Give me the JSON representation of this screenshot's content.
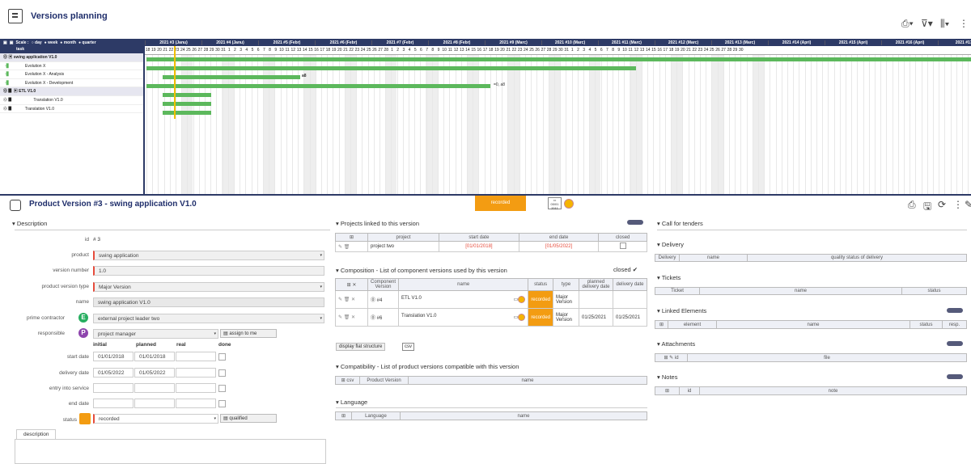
{
  "header": {
    "title": "Versions planning"
  },
  "gantt": {
    "scale_label": "Scale :",
    "scales": [
      "day",
      "week",
      "month",
      "quarter"
    ],
    "task_col": "task",
    "weeks": [
      "2021 #3 (Janu)",
      "2021 #4 (Janu)",
      "2021 #5 (Febr)",
      "2021 #6 (Febr)",
      "2021 #7 (Febr)",
      "2021 #8 (Febr)",
      "2021 #9 (Marc)",
      "2021 #10 (Marc)",
      "2021 #11 (Marc)",
      "2021 #12 (Marc)",
      "2021 #13 (Marc)",
      "2021 #14 (Apri)",
      "2021 #15 (Apri)",
      "2021 #16 (Apri)",
      "2021 #17 (A"
    ],
    "days": [
      "18",
      "19",
      "20",
      "21",
      "22",
      "23",
      "24",
      "25",
      "26",
      "27",
      "28",
      "29",
      "30",
      "31",
      "1",
      "2",
      "3",
      "4",
      "5",
      "6",
      "7",
      "8",
      "9",
      "10",
      "11",
      "12",
      "13",
      "14",
      "15",
      "16",
      "17",
      "18",
      "19",
      "20",
      "21",
      "22",
      "23",
      "24",
      "25",
      "26",
      "27",
      "28",
      "1",
      "2",
      "3",
      "4",
      "5",
      "6",
      "7",
      "8",
      "9",
      "10",
      "11",
      "12",
      "13",
      "14",
      "15",
      "16",
      "17",
      "18",
      "19",
      "20",
      "21",
      "22",
      "23",
      "24",
      "25",
      "26",
      "27",
      "28",
      "29",
      "30",
      "31",
      "1",
      "2",
      "3",
      "4",
      "5",
      "6",
      "7",
      "8",
      "9",
      "10",
      "11",
      "12",
      "13",
      "14",
      "15",
      "16",
      "17",
      "18",
      "19",
      "20",
      "21",
      "22",
      "23",
      "24",
      "25",
      "26",
      "27",
      "28",
      "29",
      "30"
    ],
    "tasks": [
      "swing application V1.0",
      "Evolution X",
      "Evolution X - Analysis",
      "Evolution X - Development",
      "ETL V1.0",
      "Translation V1.0",
      "Translation V1.0"
    ],
    "bar_labels": [
      "a8",
      "=0, a8"
    ]
  },
  "pv": {
    "title": "Product Version  #3  - swing application V1.0",
    "status_badge": "recorded",
    "description_section": "Description",
    "labels": {
      "id": "id",
      "product": "product",
      "version_number": "version number",
      "type": "product version type",
      "name": "name",
      "prime": "prime contractor",
      "responsible": "responsible",
      "start": "start date",
      "delivery": "delivery date",
      "entry": "entry into service",
      "end": "end date",
      "status": "status"
    },
    "id_value": "# 3",
    "product": "swing application",
    "version_number": "1.0",
    "type": "Major Version",
    "name": "swing application V1.0",
    "prime": "external project leader two",
    "responsible": "project manager",
    "assign_btn": "assign to me",
    "date_headers": [
      "initial",
      "planned",
      "real",
      "done"
    ],
    "start_initial": "01/01/2018",
    "start_planned": "01/01/2018",
    "delivery_initial": "01/05/2022",
    "delivery_planned": "01/05/2022",
    "status": "recorded",
    "qualified": "qualified",
    "desc_tab": "description",
    "prime_letter": "E",
    "resp_letter": "P"
  },
  "projects": {
    "title": "Projects linked to this version",
    "cols": [
      "project",
      "start date",
      "end date",
      "closed"
    ],
    "row": {
      "project": "project two",
      "start": "[01/01/2018]",
      "end": "[01/05/2022]"
    }
  },
  "composition": {
    "title": "Composition - List of component versions used by this version",
    "closed": "closed",
    "cols": [
      "Component Version",
      "name",
      "status",
      "type",
      "planned delivery date",
      "delivery date"
    ],
    "rows": [
      {
        "id": "#4",
        "name": "ETL V1.0",
        "status": "recorded",
        "type": "Major Version",
        "planned": "",
        "delivery": ""
      },
      {
        "id": "#6",
        "name": "Translation V1.0",
        "status": "recorded",
        "type": "Major Version",
        "planned": "01/25/2021",
        "delivery": "01/25/2021"
      }
    ],
    "flat_btn": "display flat structure"
  },
  "compat": {
    "title": "Compatibility - List of product versions compatible with this version",
    "cols": [
      "Product Version",
      "name"
    ]
  },
  "language": {
    "title": "Language",
    "cols": [
      "Language",
      "name"
    ]
  },
  "right": {
    "tenders": "Call for tenders",
    "delivery": "Delivery",
    "delivery_cols": [
      "Delivery",
      "name",
      "quality status of delivery"
    ],
    "tickets": "Tickets",
    "tickets_cols": [
      "Ticket",
      "name",
      "status"
    ],
    "linked": "Linked Elements",
    "linked_cols": [
      "element",
      "name",
      "status",
      "resp."
    ],
    "attach": "Attachments",
    "attach_cols": [
      "id",
      "file"
    ],
    "notes": "Notes",
    "notes_cols": [
      "id",
      "note"
    ],
    "count": "0"
  },
  "colors": {
    "navy": "#2d3a66",
    "green": "#5cb85c",
    "orange": "#f39c12"
  }
}
